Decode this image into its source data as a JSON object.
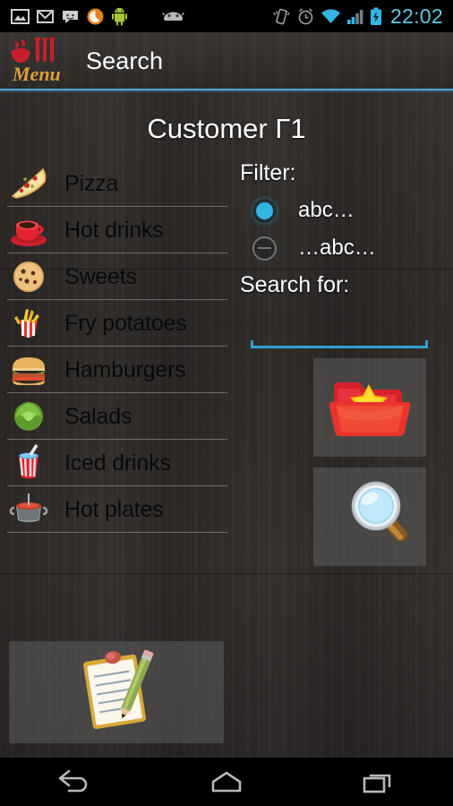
{
  "status_bar": {
    "clock": "22:02",
    "accent_color": "#5fc8e8",
    "left_icons": [
      {
        "name": "gallery-icon"
      },
      {
        "name": "gmail-icon"
      },
      {
        "name": "sms-icon"
      },
      {
        "name": "orange-app-icon"
      },
      {
        "name": "android-robot-icon"
      },
      {
        "name": "android-face-icon"
      }
    ],
    "right_icons": [
      {
        "name": "vibrate-icon"
      },
      {
        "name": "alarm-icon"
      },
      {
        "name": "wifi-icon"
      },
      {
        "name": "cell-signal-icon"
      },
      {
        "name": "battery-charging-icon"
      }
    ]
  },
  "action_bar": {
    "logo_text": "Menu",
    "title": "Search",
    "divider_color": "#4fa8d8"
  },
  "screen": {
    "title": "Customer Γ1"
  },
  "categories": [
    {
      "label": "Pizza",
      "icon": "pizza-icon"
    },
    {
      "label": "Hot drinks",
      "icon": "hot-drinks-icon"
    },
    {
      "label": "Sweets",
      "icon": "sweets-icon"
    },
    {
      "label": "Fry potatoes",
      "icon": "fry-potatoes-icon"
    },
    {
      "label": "Hamburgers",
      "icon": "hamburgers-icon"
    },
    {
      "label": "Salads",
      "icon": "salads-icon"
    },
    {
      "label": "Iced drinks",
      "icon": "iced-drinks-icon"
    },
    {
      "label": "Hot plates",
      "icon": "hot-plates-icon"
    }
  ],
  "filter": {
    "label": "Filter:",
    "options": [
      {
        "label": "abc…",
        "selected": true
      },
      {
        "label": "…abc…",
        "selected": false
      }
    ],
    "selected_color": "#33b5e5"
  },
  "search": {
    "label": "Search for:",
    "value": "",
    "placeholder": "",
    "underline_color": "#2f9fd4"
  },
  "buttons": {
    "favorites": {
      "name": "favorites-folder-button",
      "icon": "folder-star-icon"
    },
    "search": {
      "name": "search-button",
      "icon": "magnifier-icon"
    },
    "order": {
      "name": "order-notepad-button",
      "icon": "notepad-pencil-icon"
    }
  },
  "navigation_bar": {
    "back": "back-button",
    "home": "home-button",
    "recents": "recents-button"
  }
}
